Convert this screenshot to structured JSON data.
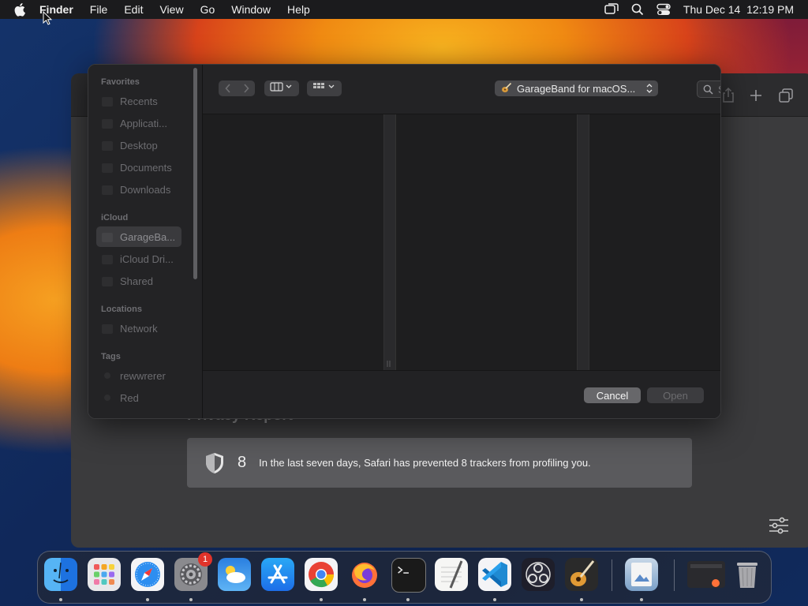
{
  "menubar": {
    "app_name": "Finder",
    "items": [
      "File",
      "Edit",
      "View",
      "Go",
      "Window",
      "Help"
    ],
    "clock": "Thu Dec 14  12:19 PM"
  },
  "safari": {
    "privacy_heading": "Privacy Report",
    "tracker_count": "8",
    "tracker_message": "In the last seven days, Safari has prevented 8 trackers from profiling you."
  },
  "dialog": {
    "location": "GarageBand for macOS...",
    "search_placeholder": "Search",
    "cancel_label": "Cancel",
    "open_label": "Open",
    "sidebar": {
      "favorites_title": "Favorites",
      "favorites": [
        "Recents",
        "Applicati...",
        "Desktop",
        "Documents",
        "Downloads"
      ],
      "icloud_title": "iCloud",
      "icloud": [
        "GarageBa...",
        "iCloud Dri...",
        "Shared"
      ],
      "locations_title": "Locations",
      "locations": [
        "Network"
      ],
      "tags_title": "Tags",
      "tags": [
        "rewwrerer",
        "Red"
      ]
    }
  },
  "dock": {
    "settings_badge": "1",
    "apps": [
      "Finder",
      "Launchpad",
      "Safari",
      "System Settings",
      "Weather",
      "App Store",
      "Chrome",
      "Firefox",
      "Terminal",
      "TextEdit",
      "VS Code",
      "OBS",
      "GarageBand",
      "Preview",
      "Window",
      "Trash"
    ]
  },
  "colors": {
    "menubar_bg": "#1b1b1d",
    "dialog_bg": "#1e1e1f",
    "selected_row": "#3a3a3d",
    "badge": "#e0332a"
  }
}
